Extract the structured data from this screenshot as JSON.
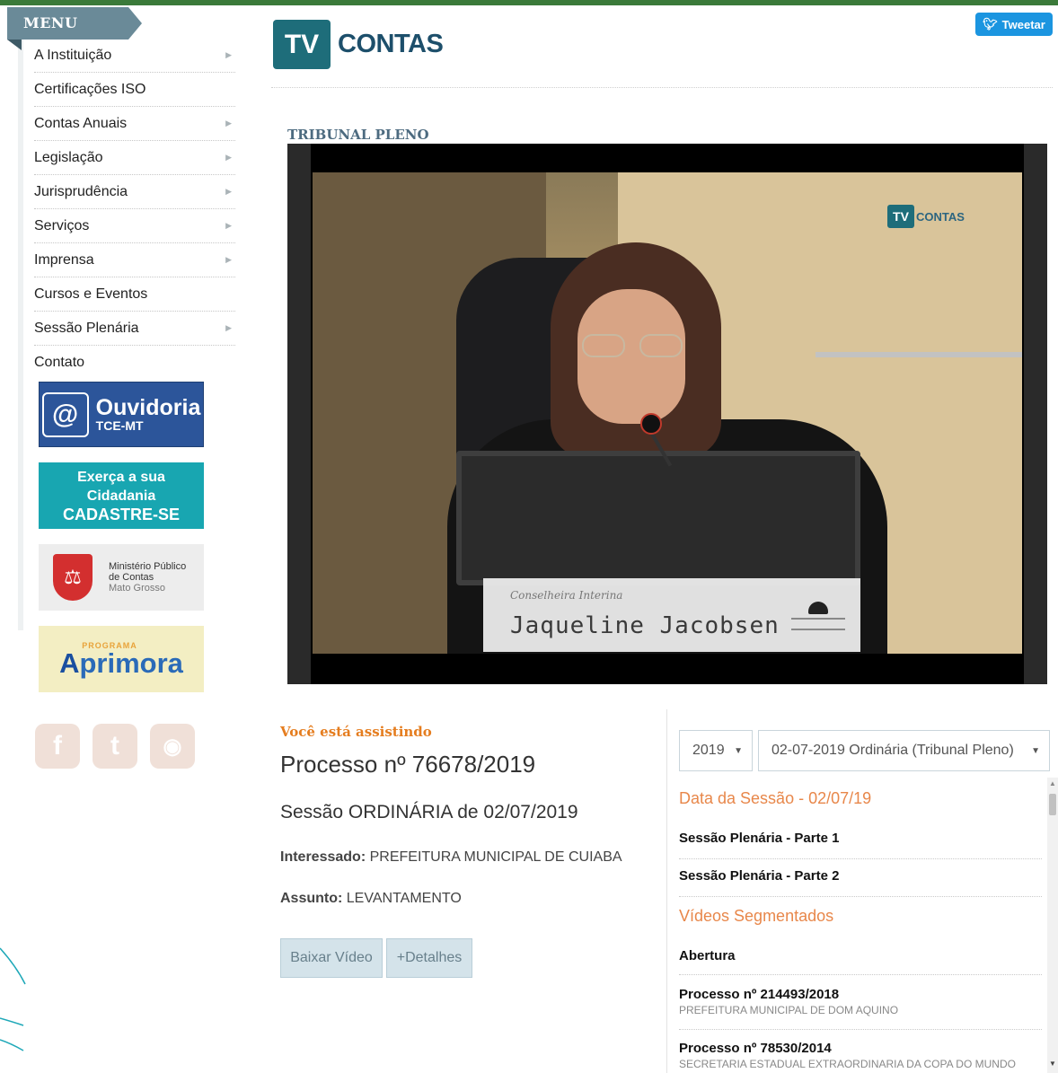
{
  "menu": {
    "title": "MENU",
    "items": [
      {
        "label": "A Instituição",
        "has_sub": true
      },
      {
        "label": "Certificações ISO",
        "has_sub": false
      },
      {
        "label": "Contas Anuais",
        "has_sub": true
      },
      {
        "label": "Legislação",
        "has_sub": true
      },
      {
        "label": "Jurisprudência",
        "has_sub": true
      },
      {
        "label": "Serviços",
        "has_sub": true
      },
      {
        "label": "Imprensa",
        "has_sub": true
      },
      {
        "label": "Cursos e Eventos",
        "has_sub": false
      },
      {
        "label": "Sessão Plenária",
        "has_sub": true
      },
      {
        "label": "Contato",
        "has_sub": false
      }
    ],
    "arrow_glyph": "▶"
  },
  "banners": {
    "ouvidoria": {
      "icon": "@",
      "title": "Ouvidoria",
      "subtitle": "TCE-MT"
    },
    "cidadania": {
      "line1": "Exerça a sua",
      "line2": "Cidadania",
      "line3": "CADASTRE-SE"
    },
    "mpc": {
      "line1": "Ministério Público",
      "line2": "de Contas",
      "line3": "Mato Grosso"
    },
    "aprimora": {
      "small": "PROGRAMA",
      "a": "A",
      "rest": "primora"
    }
  },
  "social": {
    "facebook": "f",
    "twitter": "t",
    "rss": "◉"
  },
  "header": {
    "logo_tv": "TV",
    "logo_name": "CONTAS",
    "tweet_label": "Tweetar",
    "tweet_icon": "bird-icon"
  },
  "player": {
    "section_label": "TRIBUNAL PLENO",
    "watermark_tv": "TV",
    "watermark_name": "CONTAS",
    "lower_third_role": "Conselheira Interina",
    "lower_third_name": "Jaqueline Jacobsen"
  },
  "now_playing": {
    "label": "Você está assistindo",
    "process": "Processo nº 76678/2019",
    "session": "Sessão ORDINÁRIA de 02/07/2019",
    "interessado_label": "Interessado:",
    "interessado_value": "PREFEITURA MUNICIPAL DE CUIABA",
    "assunto_label": "Assunto:",
    "assunto_value": "LEVANTAMENTO",
    "btn_download": "Baixar Vídeo",
    "btn_details": "+Detalhes"
  },
  "session_panel": {
    "year": "2019",
    "session": "02-07-2019 Ordinária (Tribunal Pleno)",
    "date_heading": "Data da Sessão - 02/07/19",
    "parts": [
      "Sessão Plenária - Parte 1",
      "Sessão Plenária - Parte 2"
    ],
    "segments_heading": "Vídeos Segmentados",
    "segments": [
      {
        "title": "Abertura",
        "subtitle": ""
      },
      {
        "title": "Processo nº 214493/2018",
        "subtitle": "PREFEITURA MUNICIPAL DE DOM AQUINO"
      },
      {
        "title": "Processo nº 78530/2014",
        "subtitle": "SECRETARIA ESTADUAL EXTRAORDINARIA DA COPA DO MUNDO"
      }
    ]
  },
  "colors": {
    "accent_orange": "#e57d1f",
    "brand_teal": "#1e6d7a",
    "menu_banner": "#6a8a98",
    "top_bar": "#3b7a3a"
  }
}
